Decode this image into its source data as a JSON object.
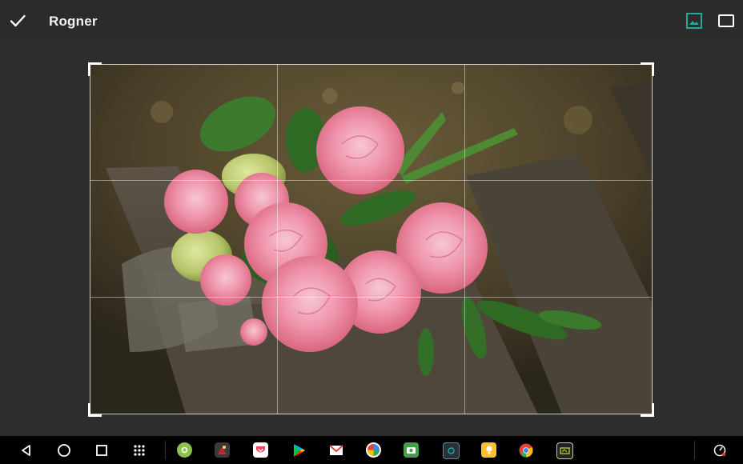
{
  "app": {
    "title": "Rogner"
  },
  "toolbar": {
    "confirm_icon": "check-icon",
    "aspect_image_icon": "image-icon",
    "aspect_rect_icon": "rectangle-icon",
    "accent": "#26a69a"
  },
  "crop": {
    "image_subject": "pink-roses-on-wooden-bench",
    "grid": "rule-of-thirds"
  },
  "taskbar": {
    "nav_icons": [
      "back-icon",
      "home-icon",
      "recents-icon",
      "app-drawer-icon"
    ],
    "apps": [
      {
        "name": "settings-app-icon",
        "color": "#8bc34a"
      },
      {
        "name": "photo-app-icon",
        "color": "#c62828"
      },
      {
        "name": "pocket-app-icon",
        "color": "#ef4056"
      },
      {
        "name": "play-store-app-icon",
        "color": "#00c853"
      },
      {
        "name": "gmail-app-icon",
        "color": "#ea4335"
      },
      {
        "name": "pinwheel-app-icon",
        "color": "#ffffff"
      },
      {
        "name": "camera-app-icon",
        "color": "#43a047"
      },
      {
        "name": "frame-app-icon",
        "color": "#26a69a"
      },
      {
        "name": "keep-app-icon",
        "color": "#fbc02d"
      },
      {
        "name": "chrome-app-icon",
        "color": "#4285f4"
      },
      {
        "name": "screen-app-icon",
        "color": "#cddc39"
      }
    ],
    "status_icon": "speed-icon"
  }
}
